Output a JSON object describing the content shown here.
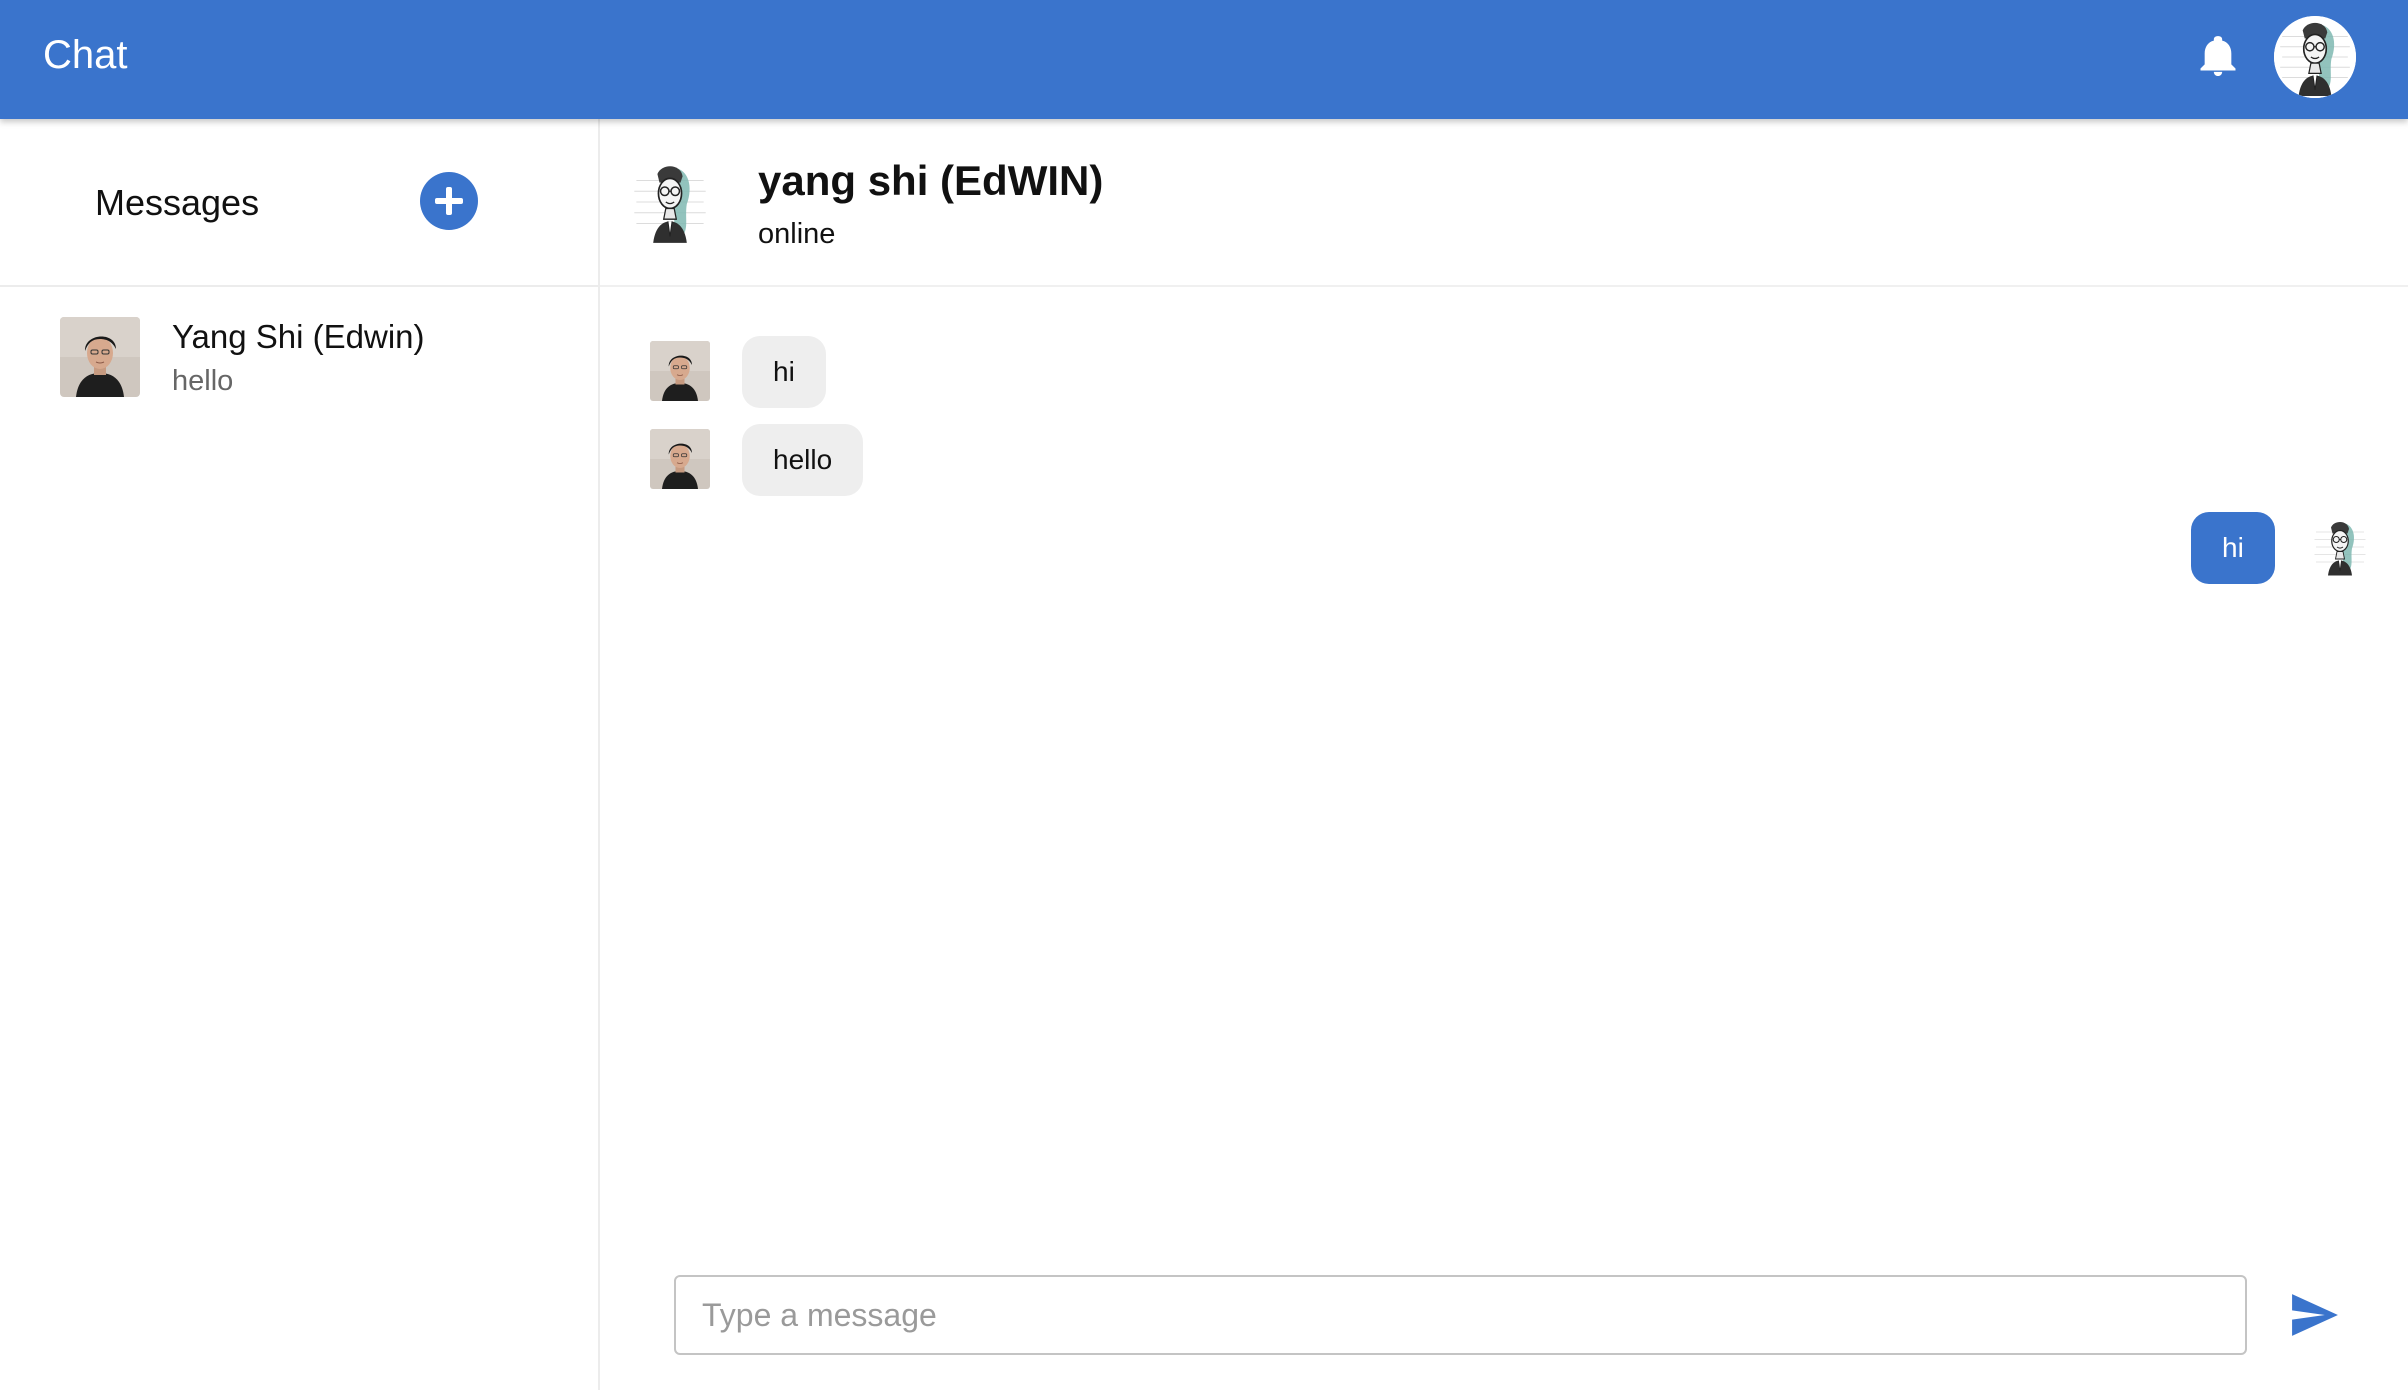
{
  "app": {
    "title": "Chat"
  },
  "header": {
    "notifications_icon": "bell-icon",
    "profile_icon": "avatar-illustration"
  },
  "sidebar": {
    "title": "Messages",
    "add_icon": "plus-icon",
    "conversations": [
      {
        "name": "Yang Shi (Edwin)",
        "preview": "hello",
        "avatar": "photo-avatar"
      }
    ]
  },
  "chat": {
    "contact_name": "yang shi (EdWIN)",
    "status": "online",
    "messages": [
      {
        "direction": "incoming",
        "text": "hi"
      },
      {
        "direction": "incoming",
        "text": "hello"
      },
      {
        "direction": "outgoing",
        "text": "hi"
      }
    ],
    "composer": {
      "placeholder": "Type a message",
      "value": "",
      "send_icon": "send-icon"
    }
  },
  "colors": {
    "primary": "#3a74cc",
    "incoming_bubble": "#eeeeee",
    "placeholder": "#9a9a9a"
  }
}
